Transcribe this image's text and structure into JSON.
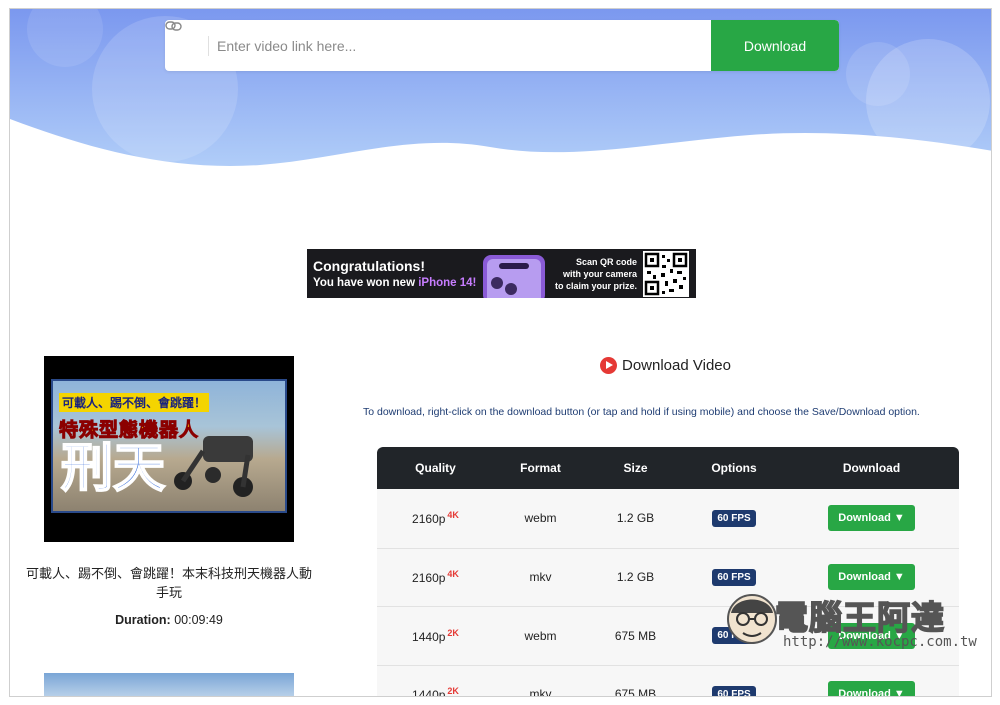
{
  "search": {
    "placeholder": "Enter video link here...",
    "button_label": "Download"
  },
  "ad": {
    "congrats": "Congratulations!",
    "won_prefix": "You have won new ",
    "won_highlight": "iPhone 14!",
    "scan_line1": "Scan QR code",
    "scan_line2": "with your camera",
    "scan_line3": "to claim your prize."
  },
  "video": {
    "thumb_line1": "可載人、踢不倒、會跳躍！",
    "thumb_line2": "特殊型態機器人",
    "thumb_line3": "刑天",
    "title": "可載人、踢不倒、會跳躍！本末科技刑天機器人動手玩",
    "duration_label": "Duration:",
    "duration_value": "00:09:49"
  },
  "download_section": {
    "title": "Download Video",
    "instructions": "To download, right-click on the download button (or tap and hold if using mobile) and choose the Save/Download option."
  },
  "table": {
    "headers": {
      "quality": "Quality",
      "format": "Format",
      "size": "Size",
      "options": "Options",
      "download": "Download"
    },
    "rows": [
      {
        "quality": "2160p",
        "badge": "4K",
        "format": "webm",
        "size": "1.2 GB",
        "option": "60 FPS",
        "button": "Download ▼"
      },
      {
        "quality": "2160p",
        "badge": "4K",
        "format": "mkv",
        "size": "1.2 GB",
        "option": "60 FPS",
        "button": "Download ▼"
      },
      {
        "quality": "1440p",
        "badge": "2K",
        "format": "webm",
        "size": "675 MB",
        "option": "60 FPS",
        "button": "Download ▼"
      },
      {
        "quality": "1440p",
        "badge": "2K",
        "format": "mkv",
        "size": "675 MB",
        "option": "60 FPS",
        "button": "Download ▼"
      }
    ]
  },
  "watermark": {
    "text": "電腦王阿達",
    "url": "http://www.kocpc.com.tw"
  },
  "colors": {
    "accent": "#28a745",
    "hero_top": "#7e9cf0",
    "hero_bottom": "#a9c8f7",
    "table_header": "#212529",
    "fps_badge": "#1e3a6e",
    "quality_badge": "#e53935"
  }
}
